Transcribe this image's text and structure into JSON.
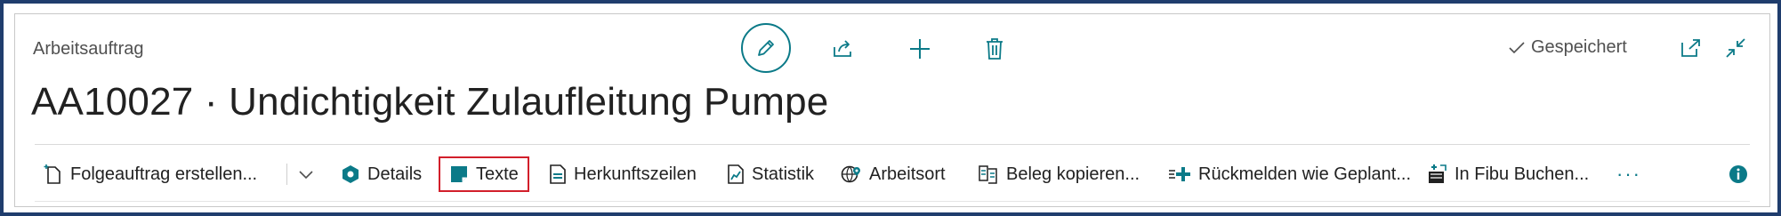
{
  "header": {
    "caption": "Arbeitsauftrag",
    "title": "AA10027 · Undichtigkeit Zulaufleitung Pumpe",
    "saved_label": "Gespeichert"
  },
  "actions": {
    "icons": [
      "pencil-icon",
      "share-icon",
      "plus-icon",
      "trash-icon",
      "open-new-window-icon",
      "collapse-icon"
    ]
  },
  "toolbar": {
    "items": [
      {
        "label": "Folgeauftrag erstellen...",
        "icon": "new-document-icon"
      },
      {
        "label": "Details",
        "icon": "details-icon"
      },
      {
        "label": "Texte",
        "icon": "texts-icon"
      },
      {
        "label": "Herkunftszeilen",
        "icon": "document-lines-icon"
      },
      {
        "label": "Statistik",
        "icon": "statistics-icon"
      },
      {
        "label": "Arbeitsort",
        "icon": "globe-location-icon"
      },
      {
        "label": "Beleg kopieren...",
        "icon": "copy-document-icon"
      },
      {
        "label": "Rückmelden wie Geplant...",
        "icon": "report-back-icon"
      },
      {
        "label": "In Fibu Buchen...",
        "icon": "post-icon"
      }
    ],
    "more_label": "···"
  },
  "colors": {
    "frame": "#1f3d6d",
    "accent": "#0b7a88",
    "highlight": "#d21f2b"
  }
}
